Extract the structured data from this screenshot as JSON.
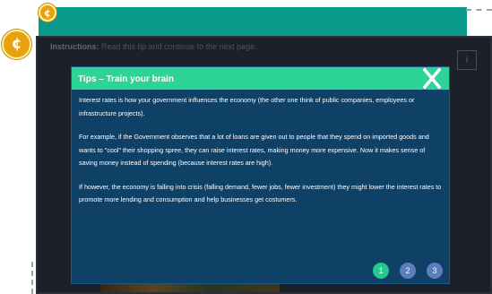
{
  "background": {
    "coin_symbol": "¢",
    "instructions_label": "Instructions:",
    "instructions_text": "Read this tip and continue to the next page.",
    "corner_button_label": "i"
  },
  "modal": {
    "title": "Tips – Train your brain",
    "paragraphs": [
      "Interest rates is how your government influences the economy (the other one think of public companies, employees or infrastructure projects).",
      "For example, if the Government observes that a lot of loans are given out to people that they spend on imported goods and wants to \"cool\" their shopping spree, they can raise interest rates, making money more expensive. Now it makes sense of saving money instead of spending (because interest rates are high).",
      "If however, the economy is falling into crisis (falling demand, fewer jobs, fewer investment) they might lower the interest rates to promote more lending and consumption and help businesses get costumers."
    ],
    "pages": [
      "1",
      "2",
      "3"
    ],
    "current_page": "1"
  },
  "colors": {
    "teal": "#0a9a8c",
    "header_green": "#2ed398",
    "modal_blue": "#0f4066",
    "active_dot": "#23c98e",
    "inactive_dot": "#5b7ec1",
    "coin": "#e8a10f"
  }
}
